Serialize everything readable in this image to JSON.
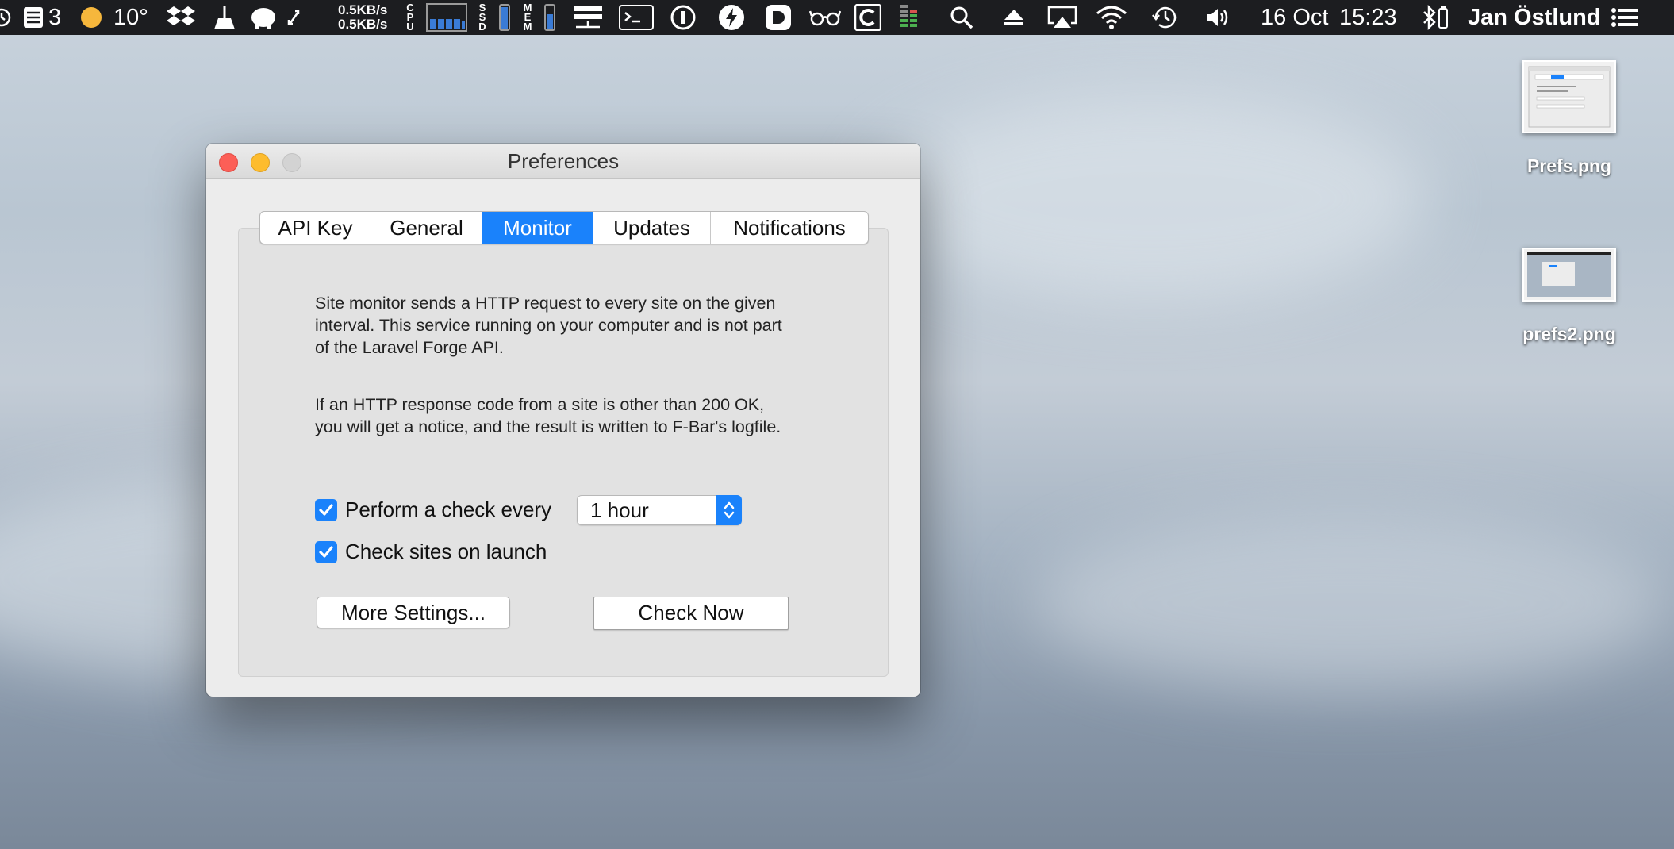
{
  "menubar": {
    "todo_count": "3",
    "temperature": "10°",
    "net_up": "0.5KB/s",
    "net_down": "0.5KB/s",
    "cpu_label": [
      "C",
      "P",
      "U"
    ],
    "ssd_label": [
      "S",
      "S",
      "D"
    ],
    "mem_label": [
      "M",
      "E",
      "M"
    ],
    "ssd_fill": 0.9,
    "mem_fill": 0.6,
    "date": "16 Oct",
    "time": "15:23",
    "user": "Jan Östlund",
    "icons": [
      "clock-icon",
      "todo-stack-icon",
      "weather-sun-icon",
      "dropbox-icon",
      "broom-icon",
      "evernote-icon",
      "sync-arrows-icon",
      "cpu-meter-icon",
      "ssd-meter-icon",
      "mem-meter-icon",
      "network-icon",
      "terminal-icon",
      "onepassword-icon",
      "bolt-icon",
      "d-app-icon",
      "glasses-icon",
      "c-app-icon",
      "battery-levels-icon",
      "spotlight-search-icon",
      "eject-icon",
      "airplay-icon",
      "wifi-icon",
      "time-machine-icon",
      "volume-icon",
      "bluetooth-icon",
      "notification-center-icon"
    ]
  },
  "desktop": {
    "icons": [
      {
        "label": "Prefs.png"
      },
      {
        "label": "prefs2.png"
      }
    ]
  },
  "window": {
    "title": "Preferences",
    "tabs": [
      {
        "label": "API Key"
      },
      {
        "label": "General"
      },
      {
        "label": "Monitor"
      },
      {
        "label": "Updates"
      },
      {
        "label": "Notifications"
      }
    ],
    "active_tab": "Monitor",
    "description_1": "Site monitor sends a HTTP request to every site on the given interval. This service running on your computer and is not part of the Laravel Forge API.",
    "description_2": "If an HTTP response code from a site is other than 200 OK, you will get a notice, and the result is written to F-Bar's logfile.",
    "perform_check": {
      "label": "Perform a check every",
      "checked": true
    },
    "interval": {
      "value": "1 hour"
    },
    "check_on_launch": {
      "label": "Check sites on launch",
      "checked": true
    },
    "more_settings_label": "More Settings...",
    "check_now_label": "Check Now"
  },
  "colors": {
    "accent": "#1a82fb",
    "close": "#fc5f57",
    "minimize": "#fdbc2e",
    "menubar": "#1c1d20"
  }
}
